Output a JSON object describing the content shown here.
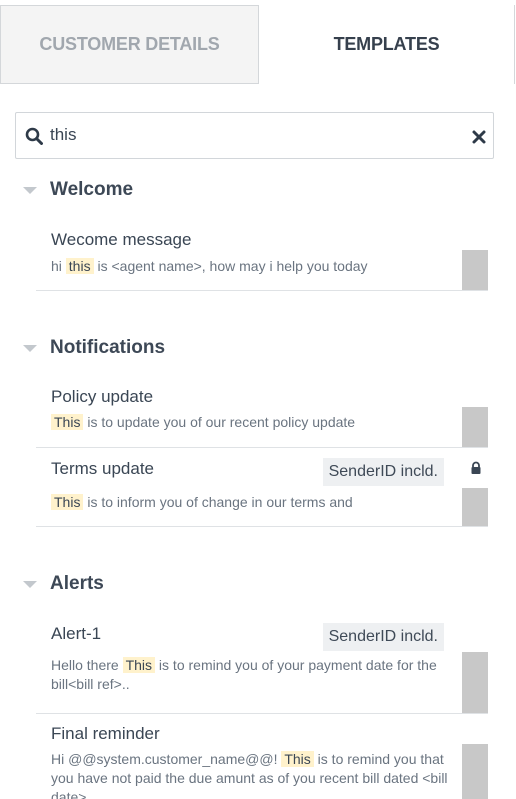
{
  "tabs": {
    "customer_details": "CUSTOMER DETAILS",
    "templates": "TEMPLATES",
    "active": "templates"
  },
  "search": {
    "value": "this",
    "icon": "search-icon",
    "clear_icon": "close-icon"
  },
  "categories": [
    {
      "title": "Welcome",
      "items": [
        {
          "name": "Wecome message",
          "preview_before": "hi ",
          "highlight": "this",
          "preview_after": " is <agent name>, how may i help you today"
        }
      ]
    },
    {
      "title": "Notifications",
      "items": [
        {
          "name": "Policy update",
          "preview_before": "",
          "highlight": "This",
          "preview_after": " is to update you of our recent policy update"
        },
        {
          "name": "Terms update",
          "badge": "SenderID incld.",
          "locked": true,
          "preview_before": "",
          "highlight": "This",
          "preview_after": " is to inform you of change in our terms and"
        }
      ]
    },
    {
      "title": "Alerts",
      "items": [
        {
          "name": "Alert-1",
          "badge": "SenderID incld.",
          "preview_before": "Hello there ",
          "highlight": "This",
          "preview_after": " is to remind you of your payment date for the bill<bill ref>.."
        },
        {
          "name": "Final reminder",
          "preview_before": "Hi @@system.customer_name@@! ",
          "highlight": "This",
          "preview_after": " is to remind you that you have not paid the due amunt as of you recent bill dated <bill date>"
        }
      ]
    }
  ],
  "colors": {
    "highlight": "#fff2cc",
    "active_tab_text": "#36404d",
    "inactive_tab_text": "#a1a7ae"
  }
}
